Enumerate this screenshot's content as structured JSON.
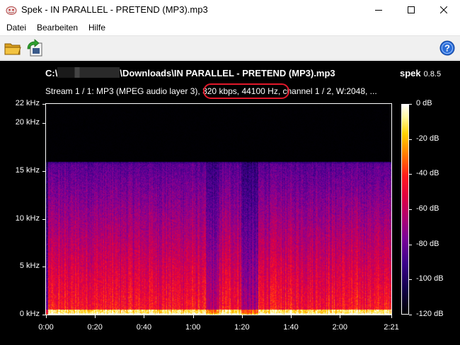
{
  "window": {
    "title": "Spek - IN PARALLEL - PRETEND (MP3).mp3",
    "minimize_icon": "minimize-icon",
    "maximize_icon": "maximize-icon",
    "close_icon": "close-icon"
  },
  "menu": {
    "items": [
      {
        "label": "Datei"
      },
      {
        "label": "Bearbeiten"
      },
      {
        "label": "Hilfe"
      }
    ]
  },
  "toolbar": {
    "open_icon": "folder-open-icon",
    "save_icon": "save-image-icon",
    "help_icon": "help-icon"
  },
  "header": {
    "path_prefix": "C:\\",
    "path_suffix": "\\Downloads\\IN PARALLEL - PRETEND (MP3).mp3",
    "app_name": "spek",
    "app_version": "0.8.5",
    "stream_info": "Stream 1 / 1: MP3 (MPEG audio layer 3), 320 kbps, 44100 Hz, channel 1 / 2, W:2048, ...",
    "highlight_color": "#e0182a"
  },
  "spectrogram": {
    "y_axis": [
      "22 kHz",
      "20 kHz",
      "15 kHz",
      "10 kHz",
      "5 kHz",
      "0 kHz"
    ],
    "x_axis": [
      "0:00",
      "0:20",
      "0:40",
      "1:00",
      "1:20",
      "1:40",
      "2:00",
      "2:21"
    ],
    "db_scale": [
      "0 dB",
      "-20 dB",
      "-40 dB",
      "-60 dB",
      "-80 dB",
      "-100 dB",
      "-120 dB"
    ],
    "cutoff_khz": 16,
    "max_khz": 22,
    "duration": "2:21"
  }
}
